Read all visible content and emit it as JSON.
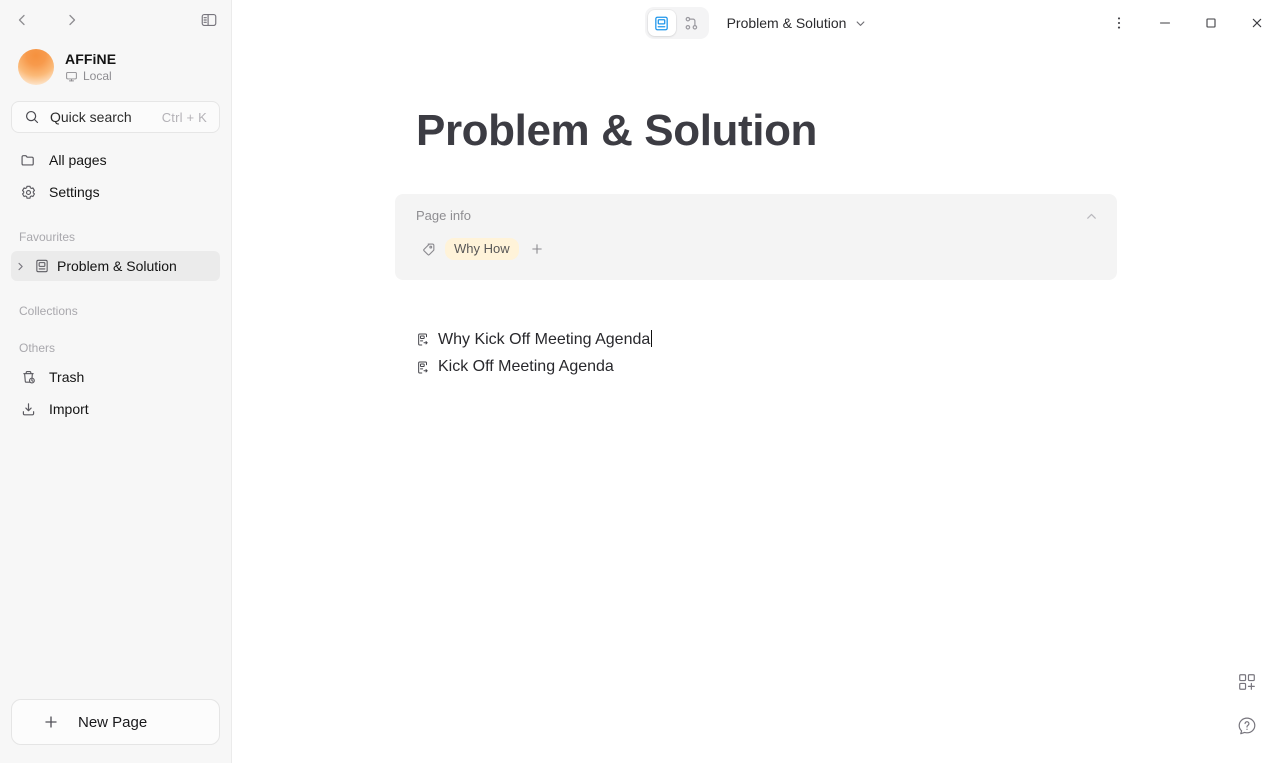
{
  "sidebar": {
    "nav_back_icon": "chevron-left-icon",
    "nav_forward_icon": "chevron-right-icon",
    "panel_toggle_icon": "sidebar-toggle-icon",
    "workspace": {
      "name": "AFFiNE",
      "sub_label": "Local",
      "sub_icon": "desktop-icon",
      "avatar_colors": [
        "#f6913e",
        "#fdf0e3"
      ]
    },
    "quick_search": {
      "label": "Quick search",
      "shortcut": "Ctrl + K",
      "icon": "search-icon"
    },
    "nav_items": [
      {
        "label": "All pages",
        "icon": "folder-icon"
      },
      {
        "label": "Settings",
        "icon": "gear-icon"
      }
    ],
    "sections": {
      "favourites": "Favourites",
      "collections": "Collections",
      "others": "Others"
    },
    "favourites": [
      {
        "label": "Problem & Solution",
        "icon": "page-icon",
        "caret": "chevron-right-icon",
        "active": true
      }
    ],
    "others": [
      {
        "label": "Trash",
        "icon": "trash-icon"
      },
      {
        "label": "Import",
        "icon": "import-icon"
      }
    ],
    "new_page": {
      "label": "New Page",
      "icon": "plus-icon"
    }
  },
  "titlebar": {
    "mode_page_icon": "page-mode-icon",
    "mode_edgeless_icon": "edgeless-mode-icon",
    "active_mode": "page",
    "doc_title": "Problem & Solution",
    "chevron_icon": "chevron-down-icon",
    "window": {
      "more_icon": "more-vertical-icon",
      "minimize_icon": "minimize-icon",
      "maximize_icon": "maximize-icon",
      "close_icon": "close-icon"
    },
    "accent_color": "#1e96eb"
  },
  "document": {
    "title": "Problem & Solution",
    "page_info": {
      "label": "Page info",
      "collapse_icon": "chevron-up-icon",
      "tag_icon": "tag-icon",
      "tags": [
        {
          "label": "Why How",
          "color": "#fff3d9"
        }
      ],
      "add_tag_label": "+"
    },
    "blocks": [
      {
        "type": "linked-doc",
        "icon": "linked-page-icon",
        "text": "Why Kick Off Meeting Agenda",
        "has_caret": true
      },
      {
        "type": "linked-doc",
        "icon": "linked-page-icon",
        "text": "Kick Off Meeting Agenda",
        "has_caret": false
      }
    ]
  },
  "corner_tools": [
    {
      "name": "add-widget-icon",
      "label": ""
    },
    {
      "name": "help-icon",
      "label": ""
    }
  ]
}
